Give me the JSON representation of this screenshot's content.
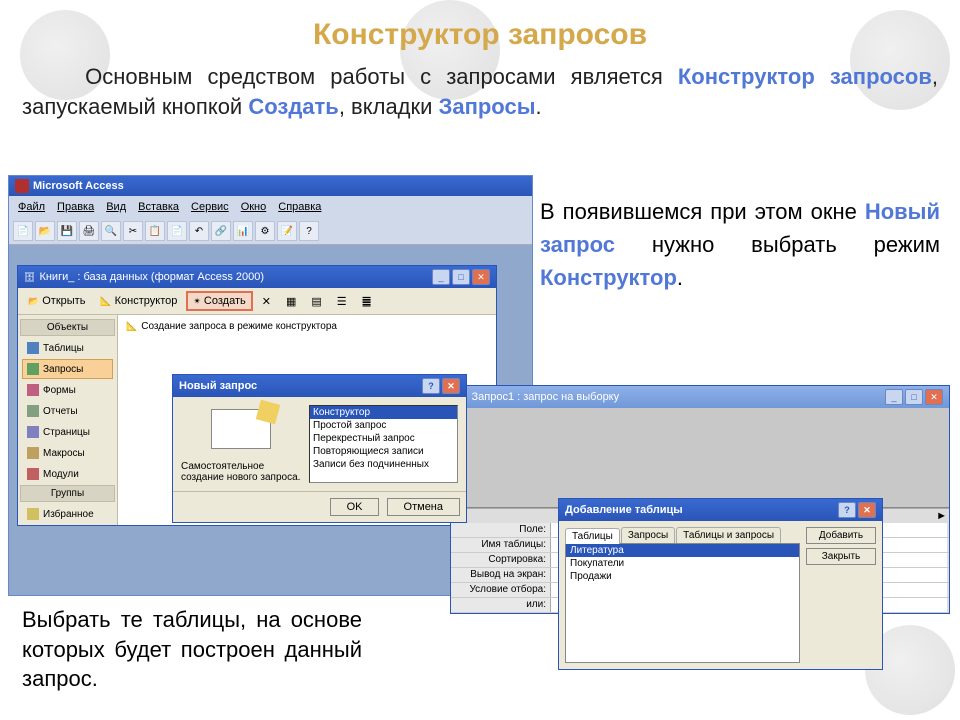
{
  "title": "Конструктор запросов",
  "intro": {
    "t1": "Основным средством работы с запросами является ",
    "hl1": "Конструктор запросов",
    "t2": ", запускаемый кнопкой ",
    "hl2": "Создать",
    "t3": ", вкладки ",
    "hl3": "Запросы",
    "t4": "."
  },
  "side": {
    "t1": "В появившемся при этом окне ",
    "hl1": "Новый запрос",
    "t2": " нужно выбрать режим ",
    "hl2": "Конструктор",
    "t3": "."
  },
  "bottom": "Выбрать те таблицы, на основе которых будет построен данный запрос.",
  "access": {
    "title": "Microsoft Access",
    "menu": [
      "Файл",
      "Правка",
      "Вид",
      "Вставка",
      "Сервис",
      "Окно",
      "Справка"
    ]
  },
  "db": {
    "title": "Книги_ : база данных (формат Access 2000)",
    "tb": {
      "open": "Открыть",
      "design": "Конструктор",
      "create": "Создать"
    },
    "side_hdr1": "Объекты",
    "side": [
      "Таблицы",
      "Запросы",
      "Формы",
      "Отчеты",
      "Страницы",
      "Макросы",
      "Модули"
    ],
    "side_hdr2": "Группы",
    "side2": [
      "Избранное"
    ],
    "main_row": "Создание запроса в режиме конструктора"
  },
  "newq": {
    "title": "Новый запрос",
    "desc": "Самостоятельное создание нового запроса.",
    "items": [
      "Конструктор",
      "Простой запрос",
      "Перекрестный запрос",
      "Повторяющиеся записи",
      "Записи без подчиненных"
    ],
    "ok": "OK",
    "cancel": "Отмена"
  },
  "qd": {
    "title": "Запрос1 : запрос на выборку",
    "rows": [
      "Поле:",
      "Имя таблицы:",
      "Сортировка:",
      "Вывод на экран:",
      "Условие отбора:",
      "или:"
    ]
  },
  "addt": {
    "title": "Добавление таблицы",
    "tabs": [
      "Таблицы",
      "Запросы",
      "Таблицы и запросы"
    ],
    "items": [
      "Литература",
      "Покупатели",
      "Продажи"
    ],
    "add": "Добавить",
    "close": "Закрыть"
  }
}
